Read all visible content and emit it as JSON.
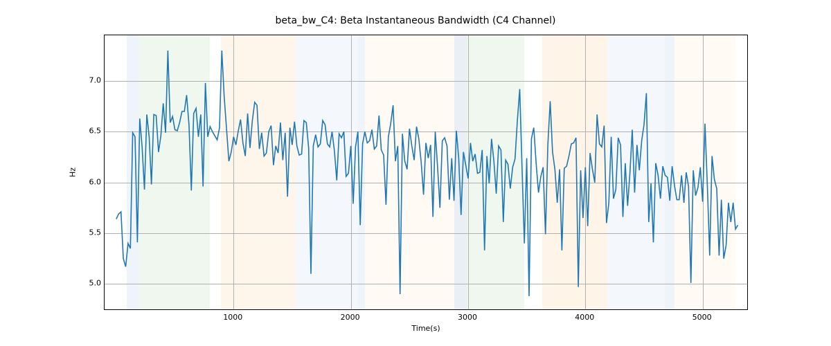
{
  "chart_data": {
    "type": "line",
    "title": "beta_bw_C4: Beta Instantaneous Bandwidth (C4 Channel)",
    "xlabel": "Time(s)",
    "ylabel": "Hz",
    "xlim": [
      -100,
      5380
    ],
    "ylim": [
      4.75,
      7.45
    ],
    "xticks": [
      1000,
      2000,
      3000,
      4000,
      5000
    ],
    "yticks": [
      5.0,
      5.5,
      6.0,
      6.5,
      7.0
    ],
    "bands": [
      {
        "x0": 90,
        "x1": 190,
        "color": "#c3d7e8"
      },
      {
        "x0": 190,
        "x1": 800,
        "color": "#c6e3c2"
      },
      {
        "x0": 890,
        "x1": 1530,
        "color": "#ffe0b8"
      },
      {
        "x0": 1530,
        "x1": 2060,
        "color": "#d7e3f0"
      },
      {
        "x0": 2060,
        "x1": 2120,
        "color": "#c3d7e8"
      },
      {
        "x0": 2120,
        "x1": 2880,
        "color": "#ffeed9"
      },
      {
        "x0": 2880,
        "x1": 2990,
        "color": "#b0c6da"
      },
      {
        "x0": 2990,
        "x1": 3480,
        "color": "#c6e3c2"
      },
      {
        "x0": 3630,
        "x1": 4190,
        "color": "#ffd9ab"
      },
      {
        "x0": 4190,
        "x1": 4680,
        "color": "#d7e3f0"
      },
      {
        "x0": 4680,
        "x1": 4760,
        "color": "#c3d7e8"
      },
      {
        "x0": 4760,
        "x1": 5280,
        "color": "#ffeed9"
      }
    ],
    "series": [
      {
        "name": "beta_bw_C4",
        "color": "#1f77b4",
        "x_step": 20,
        "x_start": 0,
        "values": [
          5.64,
          5.69,
          5.71,
          5.25,
          5.17,
          5.4,
          5.35,
          6.49,
          6.45,
          5.41,
          6.63,
          6.35,
          5.93,
          6.67,
          6.45,
          5.98,
          6.67,
          6.66,
          6.3,
          6.46,
          6.78,
          6.49,
          7.3,
          6.59,
          6.65,
          6.52,
          6.51,
          6.59,
          6.7,
          6.7,
          6.86,
          6.57,
          5.92,
          6.68,
          6.73,
          6.45,
          6.67,
          5.96,
          6.98,
          6.45,
          6.55,
          6.5,
          6.46,
          6.42,
          6.54,
          7.3,
          6.85,
          6.53,
          6.21,
          6.3,
          6.45,
          6.37,
          6.51,
          6.62,
          6.39,
          6.26,
          6.68,
          6.34,
          6.61,
          6.79,
          6.76,
          6.33,
          6.49,
          6.26,
          6.29,
          6.5,
          6.56,
          6.17,
          6.36,
          6.29,
          6.59,
          6.22,
          6.49,
          5.86,
          6.54,
          6.37,
          6.6,
          6.36,
          6.27,
          6.28,
          6.61,
          6.59,
          6.34,
          5.1,
          6.36,
          6.47,
          6.35,
          6.38,
          6.61,
          6.57,
          6.38,
          6.35,
          6.5,
          6.31,
          6.02,
          6.48,
          6.44,
          6.5,
          6.06,
          6.09,
          6.36,
          5.79,
          6.35,
          6.5,
          5.58,
          6.38,
          6.5,
          6.39,
          6.41,
          6.52,
          6.33,
          6.36,
          6.66,
          6.32,
          6.27,
          5.78,
          6.45,
          6.58,
          6.76,
          6.21,
          6.36,
          4.9,
          6.48,
          6.21,
          6.13,
          6.53,
          6.36,
          6.22,
          6.55,
          6.43,
          6.2,
          5.88,
          6.39,
          6.24,
          6.37,
          5.66,
          6.5,
          6.15,
          5.75,
          6.41,
          6.44,
          6.36,
          5.83,
          6.24,
          5.82,
          6.51,
          6.24,
          5.68,
          6.3,
          6.17,
          6.04,
          6.39,
          6.21,
          6.28,
          6.09,
          6.1,
          6.32,
          5.33,
          6.26,
          5.99,
          6.43,
          6.21,
          5.89,
          6.36,
          6.32,
          5.61,
          6.22,
          6.18,
          5.94,
          6.15,
          6.23,
          6.61,
          6.92,
          6.13,
          5.4,
          6.24,
          4.88,
          6.43,
          6.54,
          6.19,
          5.9,
          6.06,
          6.15,
          5.49,
          6.37,
          6.8,
          6.3,
          6.13,
          5.8,
          6.13,
          5.33,
          6.14,
          6.16,
          6.26,
          6.38,
          6.39,
          6.44,
          4.97,
          6.12,
          5.65,
          6.15,
          5.57,
          6.29,
          6.13,
          6.0,
          6.67,
          6.38,
          6.35,
          6.56,
          5.6,
          5.8,
          6.45,
          5.84,
          5.93,
          6.44,
          6.37,
          5.66,
          6.19,
          5.77,
          6.1,
          6.52,
          5.9,
          6.37,
          6.12,
          6.41,
          6.57,
          6.88,
          5.61,
          5.99,
          5.41,
          6.19,
          6.07,
          5.84,
          6.16,
          6.07,
          6.05,
          5.82,
          6.16,
          5.97,
          5.83,
          5.83,
          6.07,
          5.8,
          6.1,
          5.96,
          5.01,
          6.12,
          5.87,
          5.95,
          6.15,
          5.81,
          6.58,
          5.98,
          5.28,
          6.26,
          6.03,
          5.94,
          5.28,
          5.83,
          5.25,
          5.38,
          5.8,
          5.61,
          5.8,
          5.54,
          5.58
        ]
      }
    ]
  }
}
